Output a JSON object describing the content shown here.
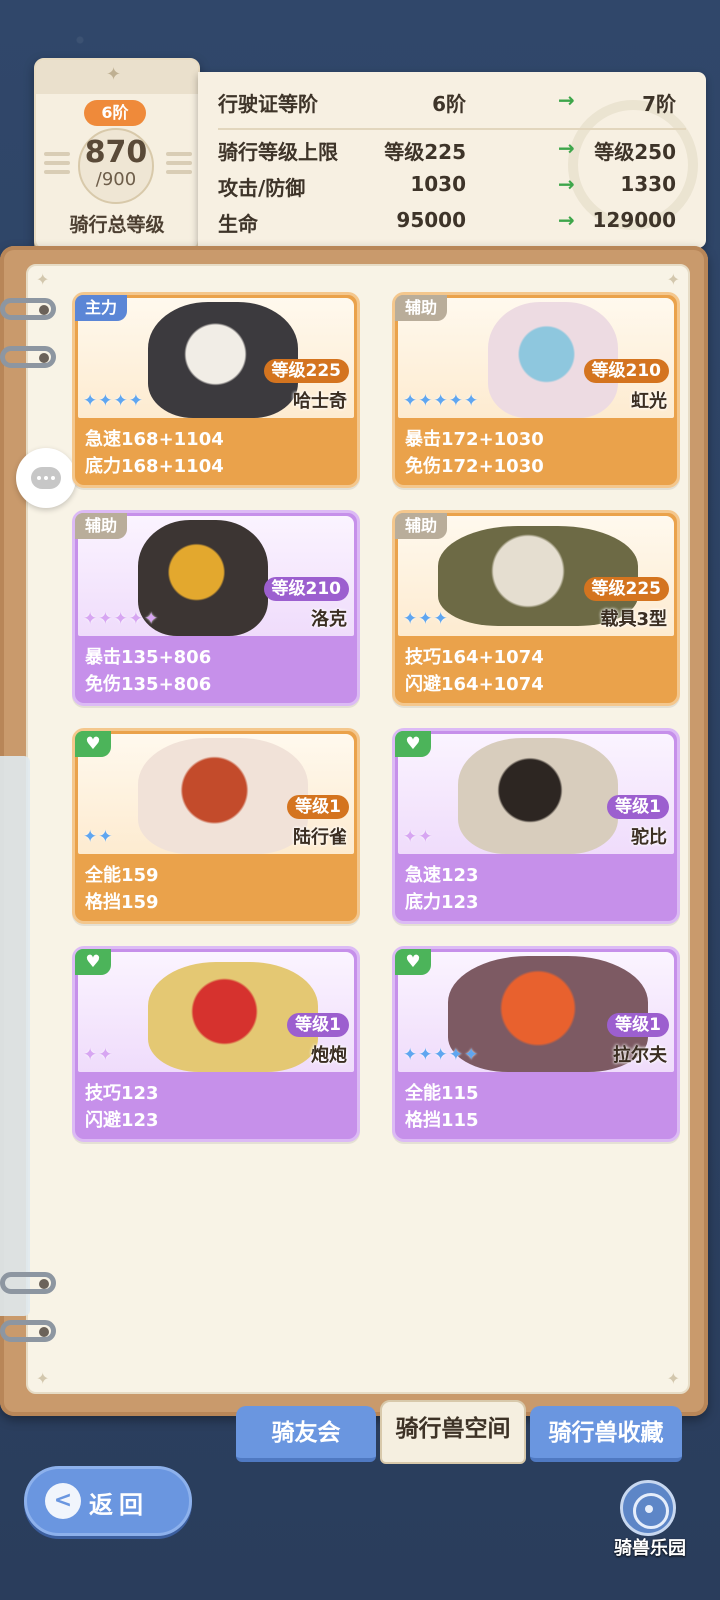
{
  "level_card": {
    "tier": "6阶",
    "current_level": "870",
    "max_level": "/900",
    "caption": "骑行总等级"
  },
  "stats": [
    {
      "label": "行驶证等阶",
      "current": "6阶",
      "arrow": "→",
      "next": "7阶"
    },
    {
      "label": "骑行等级上限",
      "current": "等级225",
      "arrow": "→",
      "next": "等级250"
    },
    {
      "label": "攻击/防御",
      "current": "1030",
      "arrow": "→",
      "next": "1330"
    },
    {
      "label": "生命",
      "current": "95000",
      "arrow": "→",
      "next": "129000"
    }
  ],
  "mounts": [
    {
      "role": "主力",
      "role_type": "main",
      "level": "等级225",
      "name": "哈士奇",
      "stars": 4,
      "star_color": "blue",
      "card_color": "orange",
      "attr1": "急速168+1104",
      "attr2": "底力168+1104"
    },
    {
      "role": "辅助",
      "role_type": "assist",
      "level": "等级210",
      "name": "虹光",
      "stars": 5,
      "star_color": "blue",
      "card_color": "orange",
      "attr1": "暴击172+1030",
      "attr2": "免伤172+1030"
    },
    {
      "role": "辅助",
      "role_type": "assist",
      "level": "等级210",
      "name": "洛克",
      "stars": 5,
      "star_color": "pink",
      "card_color": "purple",
      "attr1": "暴击135+806",
      "attr2": "免伤135+806"
    },
    {
      "role": "辅助",
      "role_type": "assist",
      "level": "等级225",
      "name": "载具3型",
      "stars": 3,
      "star_color": "blue",
      "card_color": "orange",
      "attr1": "技巧164+1074",
      "attr2": "闪避164+1074"
    },
    {
      "role": "♥",
      "role_type": "heart",
      "level": "等级1",
      "name": "陆行雀",
      "stars": 2,
      "star_color": "blue",
      "card_color": "orange",
      "attr1": "全能159",
      "attr2": "格挡159"
    },
    {
      "role": "♥",
      "role_type": "heart",
      "level": "等级1",
      "name": "驼比",
      "stars": 2,
      "star_color": "pink",
      "card_color": "purple",
      "attr1": "急速123",
      "attr2": "底力123"
    },
    {
      "role": "♥",
      "role_type": "heart",
      "level": "等级1",
      "name": "炮炮",
      "stars": 2,
      "star_color": "pink",
      "card_color": "purple",
      "attr1": "技巧123",
      "attr2": "闪避123"
    },
    {
      "role": "♥",
      "role_type": "heart",
      "level": "等级1",
      "name": "拉尔夫",
      "stars": 5,
      "star_color": "blue",
      "card_color": "purple",
      "attr1": "全能115",
      "attr2": "格挡115"
    }
  ],
  "tabs": [
    {
      "label": "骑友会",
      "active": false
    },
    {
      "label": "骑行兽空间",
      "active": true
    },
    {
      "label": "骑行兽收藏",
      "active": false
    }
  ],
  "back_button": {
    "label": "返回",
    "icon": "chevron-left-icon"
  },
  "park_button": {
    "label": "骑兽乐园",
    "icon": "ferris-wheel-icon"
  },
  "colors": {
    "card_orange": "#eaa24b",
    "card_purple": "#c690ea",
    "tag_main": "#5b86d6",
    "tag_assist": "#b9ad9a",
    "tag_heart": "#4cb45a",
    "arrow_green": "#3da64a",
    "tab_blue": "#6a96e0"
  }
}
